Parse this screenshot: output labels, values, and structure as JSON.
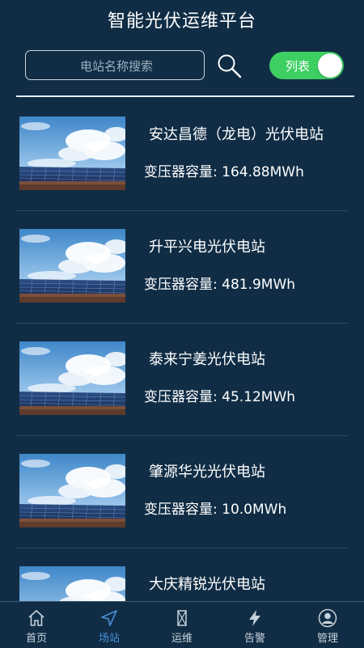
{
  "header": {
    "title": "智能光伏运维平台"
  },
  "search": {
    "placeholder": "电站名称搜索"
  },
  "toggle": {
    "label": "列表",
    "on": true,
    "color": "#3ecf63"
  },
  "stations": [
    {
      "name": "安达昌德（龙电）光伏电站",
      "capacity": "变压器容量: 164.88MWh"
    },
    {
      "name": "升平兴电光伏电站",
      "capacity": "变压器容量: 481.9MWh"
    },
    {
      "name": "泰来宁姜光伏电站",
      "capacity": "变压器容量: 45.12MWh"
    },
    {
      "name": "肇源华光光伏电站",
      "capacity": "变压器容量: 10.0MWh"
    },
    {
      "name": "大庆精锐光伏电站",
      "capacity": ""
    }
  ],
  "tabbar": {
    "active_color": "#4a8fd6",
    "tabs": [
      {
        "label": "首页",
        "icon": "home-icon"
      },
      {
        "label": "场站",
        "icon": "navigation-arrow-icon",
        "active": true
      },
      {
        "label": "运维",
        "icon": "maintenance-icon"
      },
      {
        "label": "告警",
        "icon": "lightning-icon"
      },
      {
        "label": "管理",
        "icon": "user-icon"
      }
    ]
  }
}
